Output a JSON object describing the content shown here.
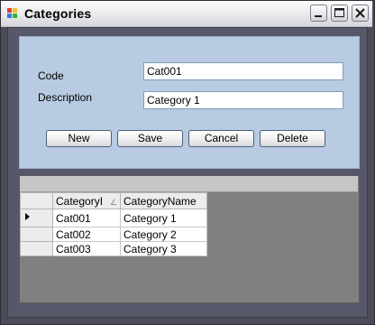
{
  "window": {
    "title": "Categories"
  },
  "form": {
    "code_label": "Code",
    "code_value": "Cat001",
    "description_label": "Description",
    "description_value": "Category 1"
  },
  "buttons": {
    "new": "New",
    "save": "Save",
    "cancel": "Cancel",
    "delete": "Delete"
  },
  "grid": {
    "columns": [
      "CategoryI",
      "CategoryName"
    ],
    "rows": [
      {
        "id": "Cat001",
        "name": "Category 1",
        "current": true
      },
      {
        "id": "Cat002",
        "name": "Category 2",
        "current": false
      },
      {
        "id": "Cat003",
        "name": "Category 3",
        "current": false
      }
    ]
  },
  "colors": {
    "panel": "#b8cbe2",
    "frame": "#4b4b59",
    "grid_background": "#808080"
  },
  "icons": [
    "app-icon",
    "minimize-icon",
    "maximize-icon",
    "close-icon",
    "row-selector-icon",
    "sort-icon"
  ]
}
